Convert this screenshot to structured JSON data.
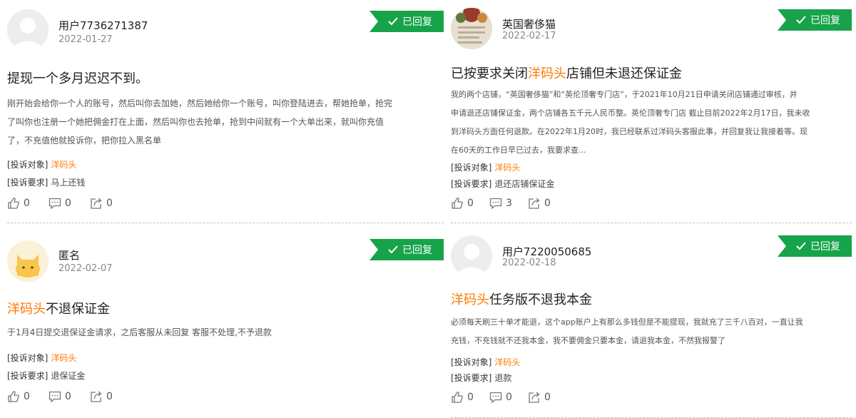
{
  "badge_label": "已回复",
  "labels": {
    "target": "[投诉对象]",
    "request": "[投诉要求]"
  },
  "colors": {
    "accent_green": "#17a34a",
    "highlight_orange": "#ff7a00"
  },
  "complaints": [
    {
      "user": "用户7736271387",
      "date": "2022-01-27",
      "avatar": "default-avatar-icon",
      "title_before": "提现一个多月迟迟不到。",
      "title_highlight": "",
      "title_after": "",
      "body_lines": [
        "刚开始会给你一个人的账号，然后叫你去加她，然后她给你一个账号，叫你登陆进去，帮她抢单，抢完",
        "了叫你也注册一个她把佣金打在上面，然后叫你也去抢单，抢到中间就有一个大单出来，就叫你充值",
        "了，不充值他就投诉你，把你拉入黑名单"
      ],
      "target": "洋码头",
      "request": "马上还钱",
      "likes": "0",
      "comments": "0",
      "shares": "0"
    },
    {
      "user": "英国奢侈猫",
      "date": "2022-02-17",
      "avatar": "shop-photo-avatar",
      "title_before": "已按要求关闭",
      "title_highlight": "洋码头",
      "title_after": "店铺但未退还保证金",
      "body_lines": [
        "我的两个店铺，“英国奢侈猫”和“英伦顶奢专门店”，于2021年10月21日申请关闭店铺通过审核，并",
        "申请退还店铺保证金，两个店铺各五千元人民币整。英伦顶奢专门店 截止目前2022年2月17日，我未收",
        "到洋码头方面任何退款。在2022年1月20时，我已经联系过洋码头客服此事，并回复我让我接着等。现",
        "在60天的工作日早已过去，我要求查..."
      ],
      "target": "洋码头",
      "request": "退还店铺保证金",
      "likes": "0",
      "comments": "3",
      "shares": "0"
    },
    {
      "user": "匿名",
      "date": "2022-02-07",
      "avatar": "cat-avatar-icon",
      "title_before": "",
      "title_highlight": "洋码头",
      "title_after": "不退保证金",
      "body_lines": [
        "于1月4日提交退保证金请求，之后客服从未回复 客服不处理,不予退款"
      ],
      "target": "洋码头",
      "request": "退保证金",
      "likes": "0",
      "comments": "0",
      "shares": "0"
    },
    {
      "user": "用户7220050685",
      "date": "2022-02-18",
      "avatar": "default-avatar-icon",
      "title_before": "",
      "title_highlight": "洋码头",
      "title_after": "任务版不退我本金",
      "body_lines": [
        "必须每天刷三十单才能退，这个app账户上有那么多钱但是不能提现，我就充了三千八百对，一直让我",
        "充钱，不充钱就不还我本金，我不要佣金只要本金，请退我本金，不然我报警了"
      ],
      "target": "洋码头",
      "request": "退款",
      "likes": "0",
      "comments": "0",
      "shares": "0"
    }
  ]
}
